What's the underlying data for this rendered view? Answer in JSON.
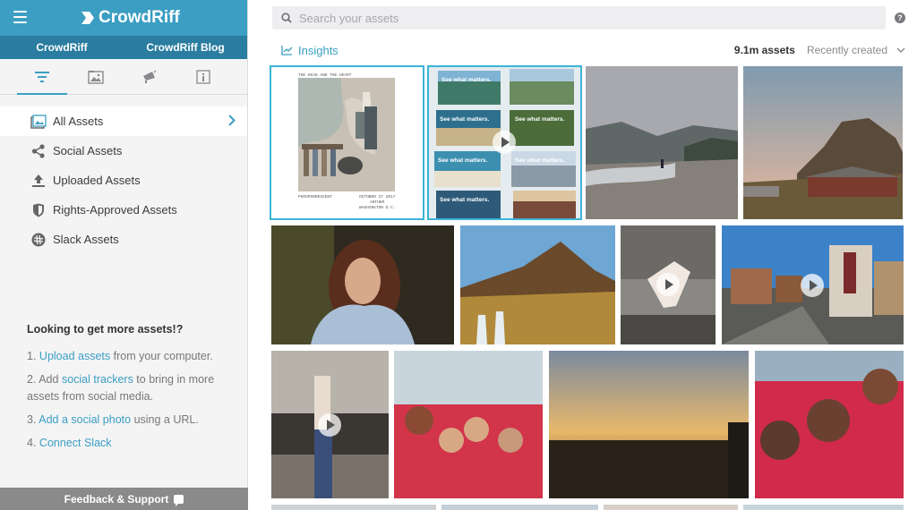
{
  "app": {
    "brand": "CrowdRiff"
  },
  "subnav": [
    "CrowdRiff",
    "CrowdRiff Blog"
  ],
  "icon_tabs": [
    "filter-icon",
    "folder-image-icon",
    "megaphone-icon",
    "info-icon"
  ],
  "nav": {
    "items": [
      {
        "label": "All Assets",
        "icon": "image-icon",
        "active": true
      },
      {
        "label": "Social Assets",
        "icon": "share-icon",
        "active": false
      },
      {
        "label": "Uploaded Assets",
        "icon": "upload-icon",
        "active": false
      },
      {
        "label": "Rights-Approved Assets",
        "icon": "shield-icon",
        "active": false
      },
      {
        "label": "Slack Assets",
        "icon": "slack-icon",
        "active": false
      }
    ]
  },
  "more": {
    "heading": "Looking to get more assets!?",
    "line1": {
      "num": "1.",
      "link": "Upload assets",
      "rest": " from your computer."
    },
    "line2": {
      "num": "2. Add ",
      "link": "social trackers",
      "rest": " to bring in more assets from social media."
    },
    "line3": {
      "num": "3.",
      "link": "Add a social photo",
      "rest": " using a URL."
    },
    "line4": {
      "num": "4.",
      "link": "Connect Slack",
      "rest": ""
    }
  },
  "feedback": "Feedback & Support",
  "search": {
    "placeholder": "Search your assets"
  },
  "toolbar": {
    "insights": "Insights",
    "count": "9.1m assets",
    "sort": "Recently created"
  },
  "poster": {
    "title": "THE HEAD AND THE HEART",
    "left": "PHOSPHORESCENT",
    "right": "OCTOBER 27 2017\nANTHEM\nWASHINGTON D.C."
  },
  "collage_caption": "See what matters.",
  "colors": {
    "accent": "#3b9ec2",
    "selection": "#3bb4d6"
  }
}
